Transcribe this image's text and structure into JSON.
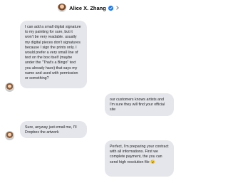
{
  "header": {
    "contact_name": "Alice X. Zhang",
    "verified_icon": "verified-badge-icon",
    "chevron_icon": "chevron-right-icon"
  },
  "messages": [
    {
      "sender": "incoming",
      "text": "I can add a small digital signature to my painting for sure, but it won't be very readable. usually my digital pieces don't signatures because I sign the prints only. I would prefer a very small line of text on the box itself (maybe under the \"That's a Bingo\" text you already have) that says my name and used with permission or something?"
    },
    {
      "sender": "outgoing",
      "text": "our customers knows artists and I'm sure they will find your official site"
    },
    {
      "sender": "incoming",
      "text": "Sure, anyway just email me, I'll Dropbox the artwork"
    },
    {
      "sender": "outgoing",
      "text": "Perfect, I'm preparing your contract with all informations. First we complete payment, the you can send high resolution file 😉"
    }
  ],
  "colors": {
    "bubble": "#e4e6eb",
    "verified": "#1877f2",
    "text": "#1c1e21"
  }
}
